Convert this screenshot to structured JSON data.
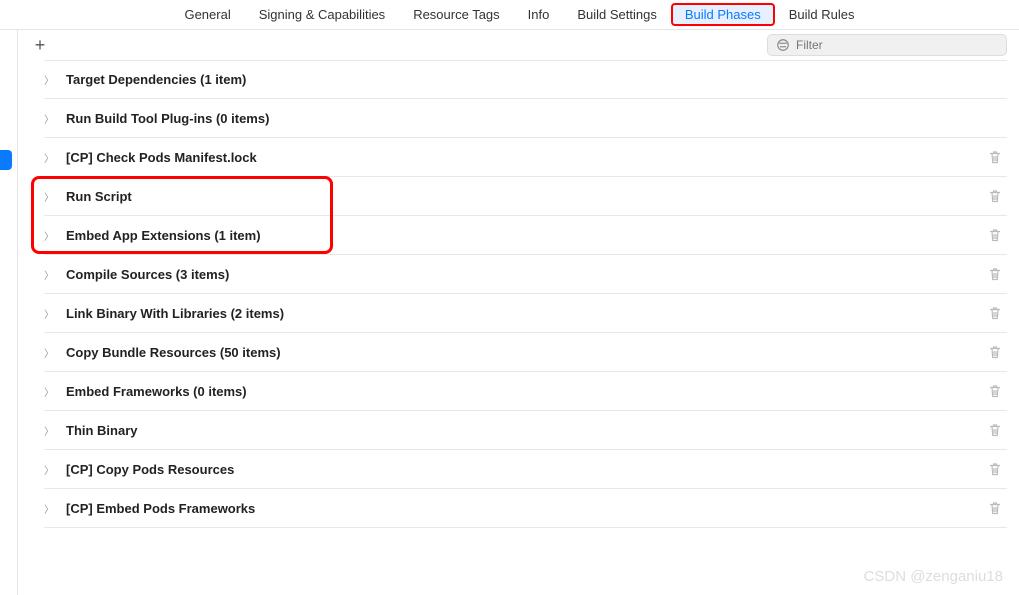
{
  "tabs": [
    "General",
    "Signing & Capabilities",
    "Resource Tags",
    "Info",
    "Build Settings",
    "Build Phases",
    "Build Rules"
  ],
  "active_tab_index": 5,
  "filter": {
    "placeholder": "Filter"
  },
  "phases": [
    {
      "title": "Target Dependencies (1 item)",
      "deletable": false
    },
    {
      "title": "Run Build Tool Plug-ins (0 items)",
      "deletable": false
    },
    {
      "title": "[CP] Check Pods Manifest.lock",
      "deletable": true
    },
    {
      "title": "Run Script",
      "deletable": true
    },
    {
      "title": "Embed App Extensions (1 item)",
      "deletable": true
    },
    {
      "title": "Compile Sources (3 items)",
      "deletable": true
    },
    {
      "title": "Link Binary With Libraries (2 items)",
      "deletable": true
    },
    {
      "title": "Copy Bundle Resources (50 items)",
      "deletable": true
    },
    {
      "title": "Embed Frameworks (0 items)",
      "deletable": true
    },
    {
      "title": "Thin Binary",
      "deletable": true
    },
    {
      "title": "[CP] Copy Pods Resources",
      "deletable": true
    },
    {
      "title": "[CP] Embed Pods Frameworks",
      "deletable": true
    }
  ],
  "watermark": "CSDN @zenganiu18"
}
